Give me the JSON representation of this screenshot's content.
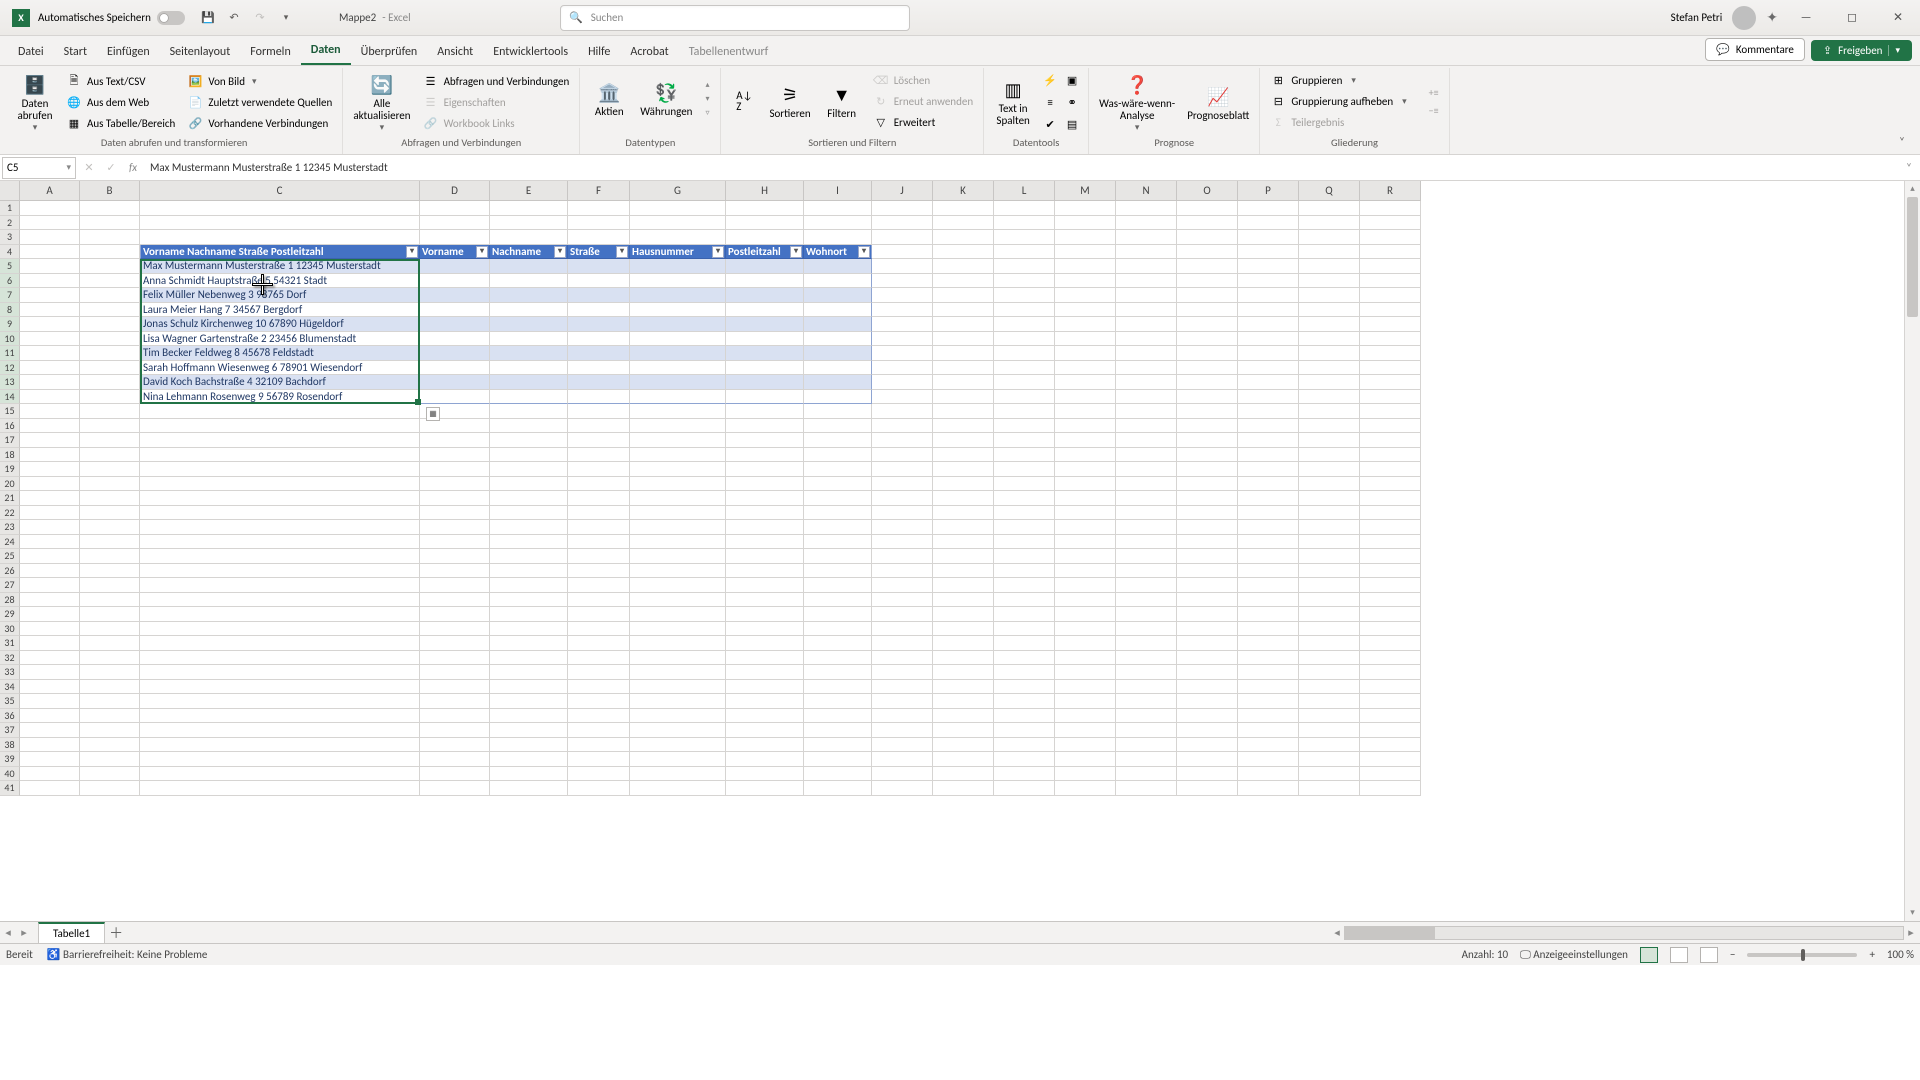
{
  "titlebar": {
    "autosave_label": "Automatisches Speichern",
    "doc_name": "Mappe2",
    "app_name": "Excel",
    "search_placeholder": "Suchen",
    "user_name": "Stefan Petri"
  },
  "tabs": {
    "items": [
      "Datei",
      "Start",
      "Einfügen",
      "Seitenlayout",
      "Formeln",
      "Daten",
      "Überprüfen",
      "Ansicht",
      "Entwicklertools",
      "Hilfe",
      "Acrobat",
      "Tabellenentwurf"
    ],
    "active_index": 5,
    "comments_label": "Kommentare",
    "share_label": "Freigeben"
  },
  "ribbon": {
    "groups": {
      "get_data": {
        "big": "Daten\nabrufen",
        "items": [
          "Aus Text/CSV",
          "Aus dem Web",
          "Aus Tabelle/Bereich",
          "Von Bild",
          "Zuletzt verwendete Quellen",
          "Vorhandene Verbindungen"
        ],
        "label": "Daten abrufen und transformieren"
      },
      "queries": {
        "big": "Alle\naktualisieren",
        "items": [
          "Abfragen und Verbindungen",
          "Eigenschaften",
          "Workbook Links"
        ],
        "label": "Abfragen und Verbindungen"
      },
      "datatypes": {
        "stocks": "Aktien",
        "currencies": "Währungen",
        "label": "Datentypen"
      },
      "sortfilter": {
        "sort": "Sortieren",
        "filter": "Filtern",
        "items": [
          "Löschen",
          "Erneut anwenden",
          "Erweitert"
        ],
        "label": "Sortieren und Filtern"
      },
      "datatools": {
        "text_to_cols": "Text in\nSpalten",
        "label": "Datentools"
      },
      "forecast": {
        "whatif": "Was-wäre-wenn-\nAnalyse",
        "sheet": "Prognoseblatt",
        "label": "Prognose"
      },
      "outline": {
        "items": [
          "Gruppieren",
          "Gruppierung aufheben",
          "Teilergebnis"
        ],
        "label": "Gliederung"
      }
    }
  },
  "fbar": {
    "namebox": "C5",
    "formula": "Max Mustermann Musterstraße 1 12345 Musterstadt"
  },
  "columns": [
    "A",
    "B",
    "C",
    "D",
    "E",
    "F",
    "G",
    "H",
    "I",
    "J",
    "K",
    "L",
    "M",
    "N",
    "O",
    "P",
    "Q",
    "R"
  ],
  "table1": {
    "header": "Vorname Nachname Straße Postleitzahl",
    "rows": [
      "Max Mustermann Musterstraße 1 12345 Musterstadt",
      "Anna Schmidt Hauptstraße 5 54321 Stadt",
      "Felix Müller Nebenweg 3 98765 Dorf",
      "Laura Meier Hang 7 34567 Bergdorf",
      "Jonas Schulz Kirchenweg 10 67890 Hügeldorf",
      "Lisa Wagner Gartenstraße 2 23456 Blumenstadt",
      "Tim Becker Feldweg 8 45678 Feldstadt",
      "Sarah Hoffmann Wiesenweg 6 78901 Wiesendorf",
      "David Koch Bachstraße 4 32109 Bachdorf",
      "Nina Lehmann Rosenweg 9 56789 Rosendorf"
    ]
  },
  "table2_headers": [
    "Vorname",
    "Nachname",
    "Straße",
    "Hausnummer",
    "Postleitzahl",
    "Wohnort"
  ],
  "sheet_tab": "Tabelle1",
  "status": {
    "ready": "Bereit",
    "access": "Barrierefreiheit: Keine Probleme",
    "count_label": "Anzahl:",
    "count_value": "10",
    "display_settings": "Anzeigeeinstellungen",
    "zoom": "100 %"
  }
}
